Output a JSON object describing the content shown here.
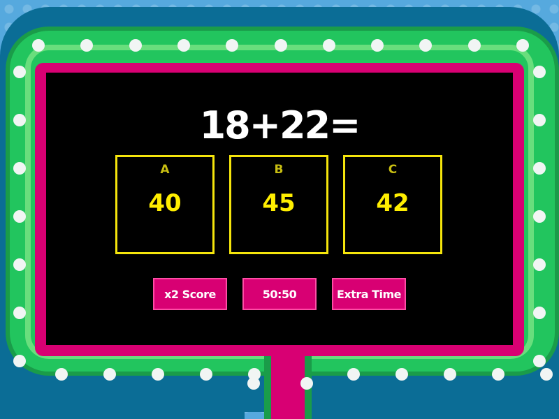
{
  "question": "18+22=",
  "answers": [
    {
      "letter": "A",
      "value": "40"
    },
    {
      "letter": "B",
      "value": "45"
    },
    {
      "letter": "C",
      "value": "42"
    }
  ],
  "powerups": [
    "x2 Score",
    "50:50",
    "Extra Time"
  ],
  "colors": {
    "background": "#56a9de",
    "frame_green": "#22c55e",
    "screen_border": "#d80073",
    "screen": "#000000",
    "answer_border": "#f5e50c",
    "answer_text": "#ffee00"
  }
}
